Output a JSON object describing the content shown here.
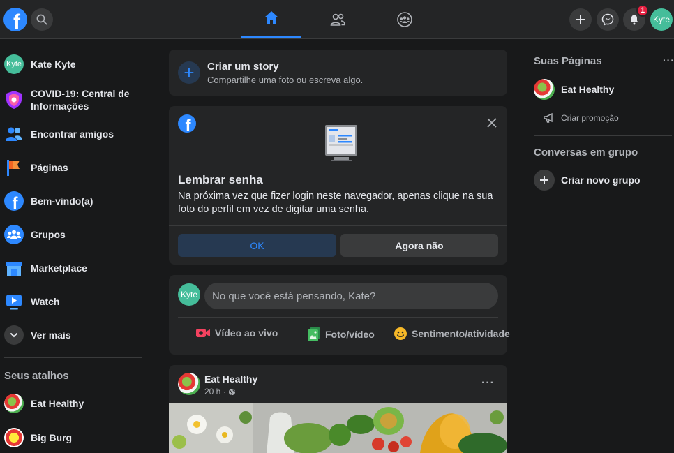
{
  "topbar": {
    "logo_letter": "f",
    "notification_count": "1",
    "user_avatar_text": "Kyte"
  },
  "left_sidebar": {
    "items": [
      {
        "label": "Kate Kyte",
        "avatar_text": "Kyte"
      },
      {
        "label_line1": "COVID-19: Central de",
        "label_line2": "Informações"
      },
      {
        "label": "Encontrar amigos"
      },
      {
        "label": "Páginas"
      },
      {
        "label": "Bem-vindo(a)"
      },
      {
        "label": "Grupos"
      },
      {
        "label": "Marketplace"
      },
      {
        "label": "Watch"
      },
      {
        "label": "Ver mais"
      }
    ],
    "shortcuts_heading": "Seus atalhos",
    "shortcuts": [
      {
        "label": "Eat Healthy"
      },
      {
        "label": "Big Burg"
      }
    ]
  },
  "story": {
    "title": "Criar um story",
    "subtitle": "Compartilhe uma foto ou escreva algo."
  },
  "remember_password": {
    "title": "Lembrar senha",
    "text": "Na próxima vez que fizer login neste navegador, apenas clique na sua foto do perfil em vez de digitar uma senha.",
    "ok_label": "OK",
    "not_now_label": "Agora não"
  },
  "composer": {
    "avatar_text": "Kyte",
    "placeholder": "No que você está pensando, Kate?",
    "actions": [
      {
        "label": "Vídeo ao vivo"
      },
      {
        "label": "Foto/vídeo"
      },
      {
        "label": "Sentimento/atividade"
      }
    ]
  },
  "post": {
    "author": "Eat Healthy",
    "time": "20 h ·",
    "more": "···"
  },
  "right_sidebar": {
    "pages_heading": "Suas Páginas",
    "more": "···",
    "page_name": "Eat Healthy",
    "create_promo": "Criar promoção",
    "groups_heading": "Conversas em grupo",
    "create_group": "Criar novo grupo"
  },
  "colors": {
    "background": "#18191a",
    "surface": "#242526",
    "accent": "#2d88ff",
    "badge": "#e41e3f"
  }
}
